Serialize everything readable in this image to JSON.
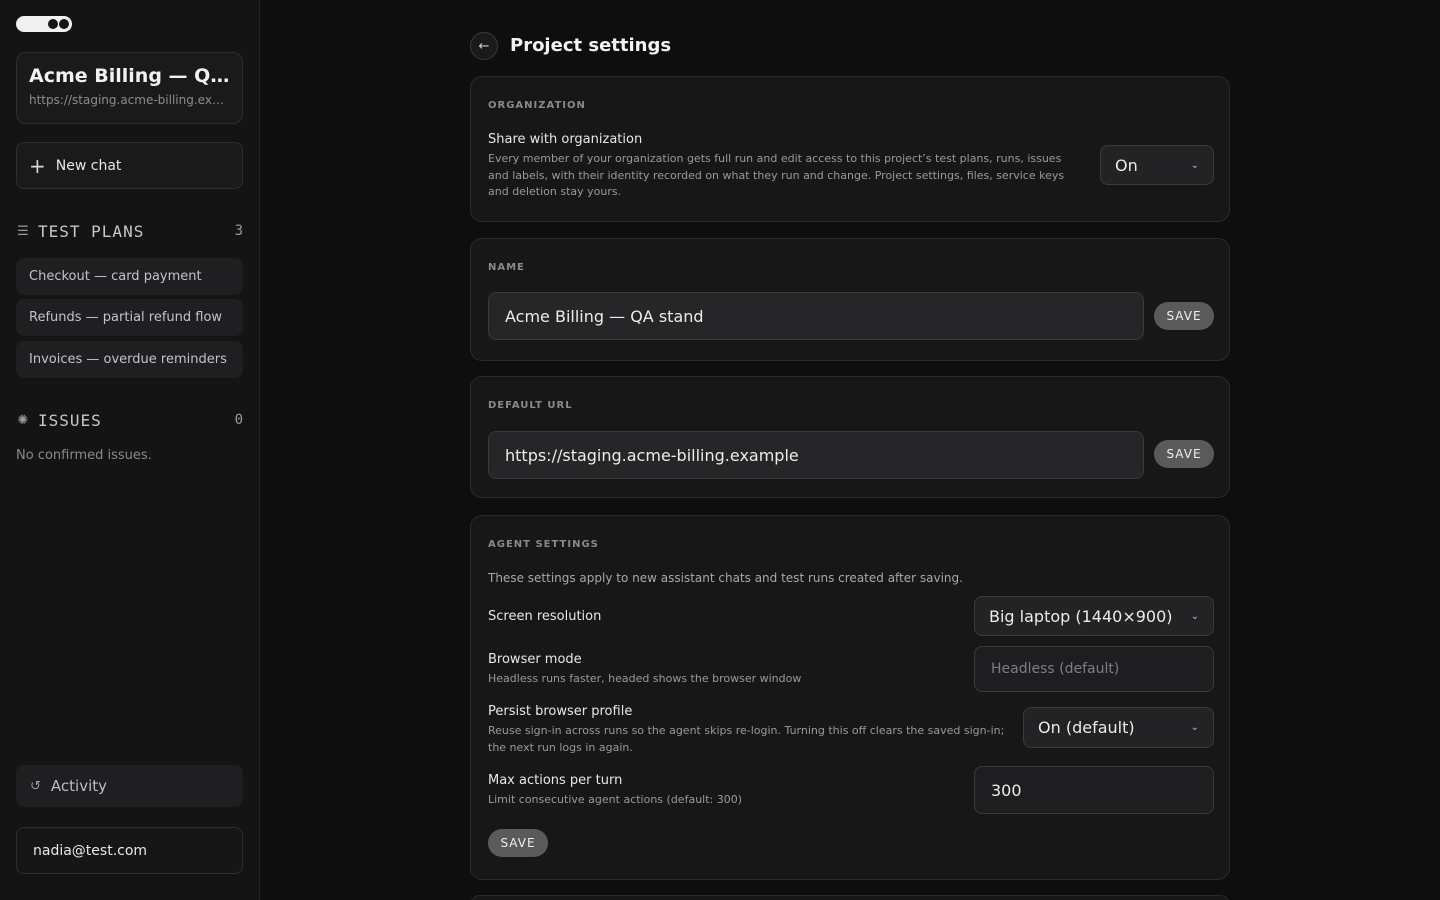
{
  "sidebar": {
    "project": {
      "title": "Acme Billing — QA stand",
      "url": "https://staging.acme-billing.example"
    },
    "new_chat_label": "New chat",
    "test_plans": {
      "title": "TEST PLANS",
      "count": "3",
      "items": [
        {
          "label": "Checkout — card payment"
        },
        {
          "label": "Refunds — partial refund flow"
        },
        {
          "label": "Invoices — overdue reminders"
        }
      ]
    },
    "issues": {
      "title": "ISSUES",
      "count": "0",
      "empty_text": "No confirmed issues."
    },
    "activity_label": "Activity",
    "user_email": "nadia@test.com"
  },
  "page": {
    "title": "Project settings",
    "organization": {
      "label": "ORGANIZATION",
      "share_title": "Share with organization",
      "share_desc": "Every member of your organization gets full run and edit access to this project’s test plans, runs, issues and labels, with their identity recorded on what they run and change. Project settings, files, service keys and deletion stay yours.",
      "share_value": "On"
    },
    "name": {
      "label": "NAME",
      "value": "Acme Billing — QA stand",
      "save_label": "SAVE"
    },
    "default_url": {
      "label": "DEFAULT URL",
      "value": "https://staging.acme-billing.example",
      "save_label": "SAVE"
    },
    "agent": {
      "label": "AGENT SETTINGS",
      "intro": "These settings apply to new assistant chats and test runs created after saving.",
      "resolution_title": "Screen resolution",
      "resolution_value": "Big laptop (1440×900)",
      "browser_mode_title": "Browser mode",
      "browser_mode_desc": "Headless runs faster, headed shows the browser window",
      "browser_mode_placeholder": "Headless (default)",
      "persist_title": "Persist browser profile",
      "persist_desc": "Reuse sign-in across runs so the agent skips re-login. Turning this off clears the saved sign-in; the next run logs in again.",
      "persist_value": "On (default)",
      "max_actions_title": "Max actions per turn",
      "max_actions_desc": "Limit consecutive agent actions (default: 300)",
      "max_actions_value": "300",
      "save_label": "SAVE"
    }
  }
}
